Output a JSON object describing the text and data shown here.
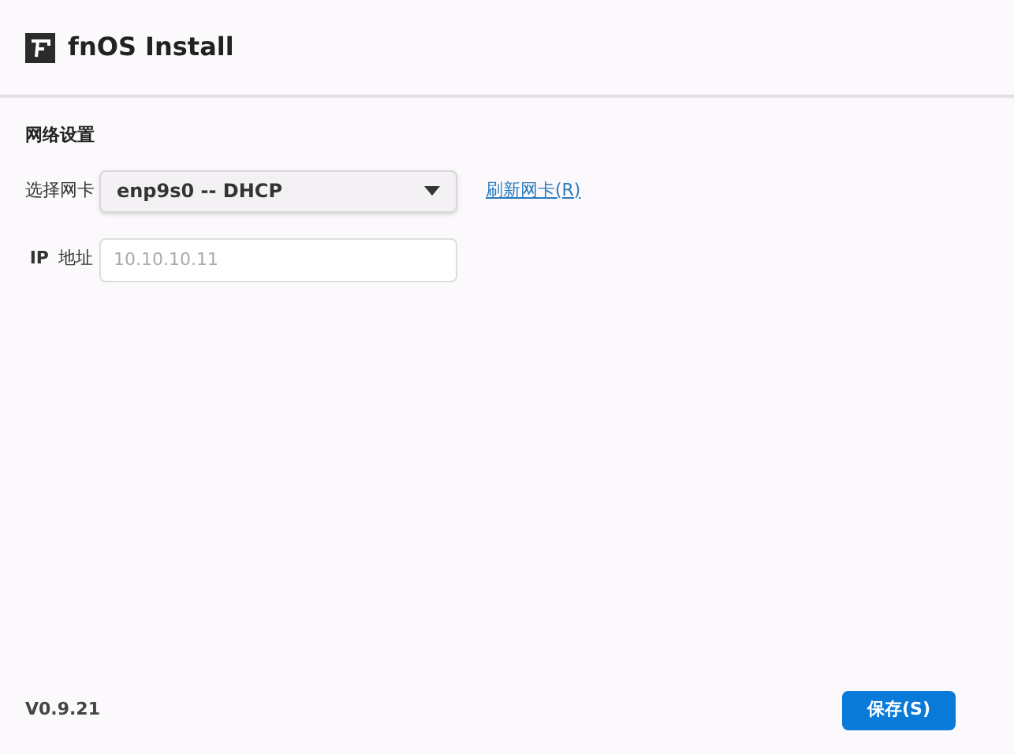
{
  "window": {
    "title": "fnOS Install"
  },
  "section": {
    "title": "网络设置"
  },
  "nic": {
    "label": "选择网卡",
    "value": "enp9s0 -- DHCP",
    "refresh_link": "刷新网卡(R)"
  },
  "ip": {
    "label_prefix": "IP",
    "label": "地址",
    "placeholder": "10.10.10.11"
  },
  "footer": {
    "version": "V0.9.21",
    "save_button": "保存(S)"
  }
}
